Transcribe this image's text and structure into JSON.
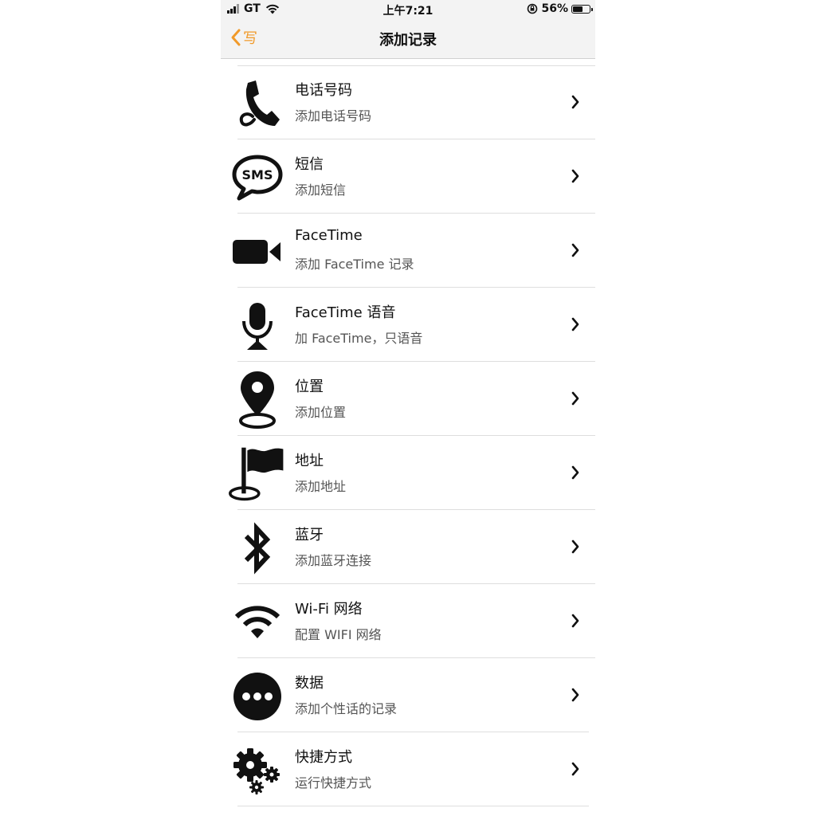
{
  "status_bar": {
    "carrier": "GT",
    "time": "上午7:21",
    "battery_percent": "56%",
    "battery_level": 0.56
  },
  "nav": {
    "back_label": "写",
    "title": "添加记录",
    "accent_color": "#f19a2a"
  },
  "items": [
    {
      "icon": "phone-icon",
      "title": "电话号码",
      "subtitle": "添加电话号码"
    },
    {
      "icon": "sms-bubble-icon",
      "title": "短信",
      "subtitle": "添加短信"
    },
    {
      "icon": "video-camera-icon",
      "title": "FaceTime",
      "subtitle": "添加 FaceTime 记录"
    },
    {
      "icon": "microphone-icon",
      "title": "FaceTime 语音",
      "subtitle": "加 FaceTime，只语音"
    },
    {
      "icon": "location-pin-icon",
      "title": "位置",
      "subtitle": "添加位置"
    },
    {
      "icon": "flag-icon",
      "title": "地址",
      "subtitle": "添加地址"
    },
    {
      "icon": "bluetooth-icon",
      "title": "蓝牙",
      "subtitle": "添加蓝牙连接"
    },
    {
      "icon": "wifi-icon",
      "title": "Wi-Fi 网络",
      "subtitle": "配置 WIFI 网络"
    },
    {
      "icon": "more-dots-icon",
      "title": "数据",
      "subtitle": "添加个性话的记录"
    },
    {
      "icon": "gears-icon",
      "title": "快捷方式",
      "subtitle": "运行快捷方式"
    }
  ]
}
